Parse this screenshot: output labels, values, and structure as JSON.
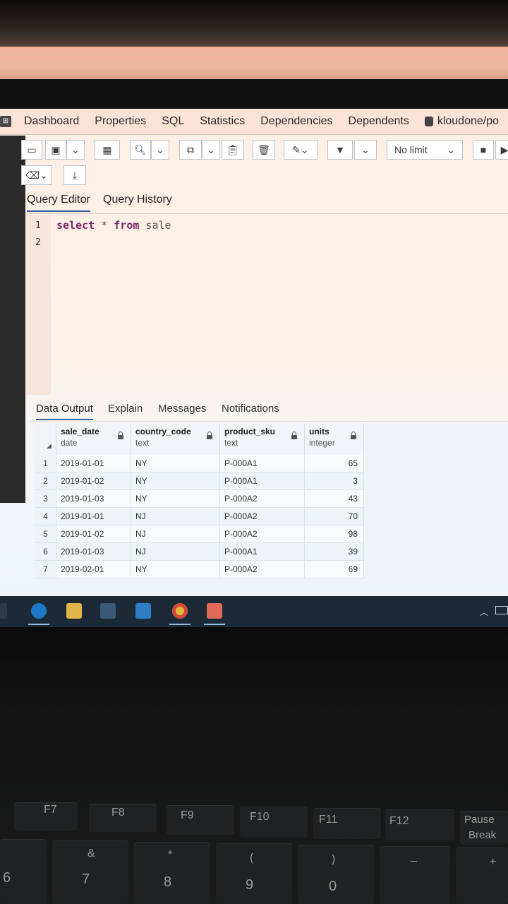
{
  "topnav": {
    "tabs": [
      "Dashboard",
      "Properties",
      "SQL",
      "Statistics",
      "Dependencies",
      "Dependents"
    ],
    "connection": "kloudone/po"
  },
  "toolbar": {
    "limit_label": "No limit"
  },
  "editor_tabs": [
    "Query Editor",
    "Query History"
  ],
  "editor": {
    "line_numbers": [
      "1",
      "2"
    ],
    "keyword_select": "select",
    "star": " * ",
    "keyword_from": "from",
    "table": " sale"
  },
  "output_tabs": [
    "Data Output",
    "Explain",
    "Messages",
    "Notifications"
  ],
  "grid": {
    "columns": [
      {
        "name": "sale_date",
        "type": "date"
      },
      {
        "name": "country_code",
        "type": "text"
      },
      {
        "name": "product_sku",
        "type": "text"
      },
      {
        "name": "units",
        "type": "integer"
      }
    ],
    "rows": [
      [
        "1",
        "2019-01-01",
        "NY",
        "P-000A1",
        "65"
      ],
      [
        "2",
        "2019-01-02",
        "NY",
        "P-000A1",
        "3"
      ],
      [
        "3",
        "2019-01-03",
        "NY",
        "P-000A2",
        "43"
      ],
      [
        "4",
        "2019-01-01",
        "NJ",
        "P-000A2",
        "70"
      ],
      [
        "5",
        "2019-01-02",
        "NJ",
        "P-000A2",
        "98"
      ],
      [
        "6",
        "2019-01-03",
        "NJ",
        "P-000A1",
        "39"
      ],
      [
        "7",
        "2019-02-01",
        "NY",
        "P-000A2",
        "69"
      ]
    ]
  },
  "keyboard": {
    "fkeys": [
      "F7",
      "F8",
      "F9",
      "F10",
      "F11",
      "F12",
      "Pause",
      "Break"
    ],
    "num_main": [
      "6",
      "7",
      "8",
      "9",
      "0"
    ],
    "num_sub": [
      "&",
      "*",
      "(",
      ")"
    ],
    "symbols": [
      "_",
      "+"
    ]
  },
  "colors": {
    "accent": "#2c5f9e",
    "taskbar": "#1b2a36"
  }
}
